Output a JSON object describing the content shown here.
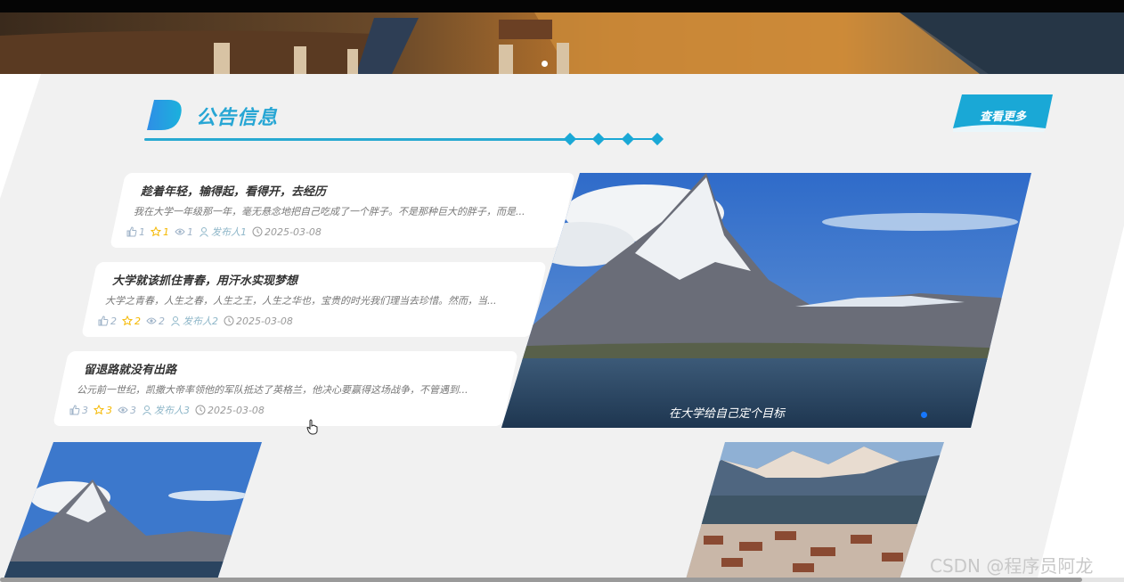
{
  "section": {
    "title": "公告信息",
    "more_label": "查看更多",
    "accent": "#27a6d4"
  },
  "notices": [
    {
      "title": "趁着年轻，输得起，看得开，去经历",
      "summary": "我在大学一年级那一年，毫无悬念地把自己吃成了一个胖子。不是那种巨大的胖子，而是...",
      "likes": "1",
      "favorites": "1",
      "views": "1",
      "publisher": "发布人1",
      "date": "2025-03-08"
    },
    {
      "title": "大学就该抓住青春，用汗水实现梦想",
      "summary": "大学之青春，人生之春，人生之王，人生之华也，宝贵的时光我们理当去珍惜。然而，当...",
      "likes": "2",
      "favorites": "2",
      "views": "2",
      "publisher": "发布人2",
      "date": "2025-03-08"
    },
    {
      "title": "留退路就没有出路",
      "summary": "公元前一世纪，凯撒大帝率领他的军队抵达了英格兰，他决心要赢得这场战争，不管遇到...",
      "likes": "3",
      "favorites": "3",
      "views": "3",
      "publisher": "发布人3",
      "date": "2025-03-08"
    }
  ],
  "feature": {
    "caption": "在大学给自己定个目标"
  },
  "watermark": "CSDN @程序员阿龙",
  "icons": {
    "like": "thumbs-up-icon",
    "favorite": "star-icon",
    "view": "eye-icon",
    "publisher": "user-icon",
    "date": "clock-icon"
  }
}
